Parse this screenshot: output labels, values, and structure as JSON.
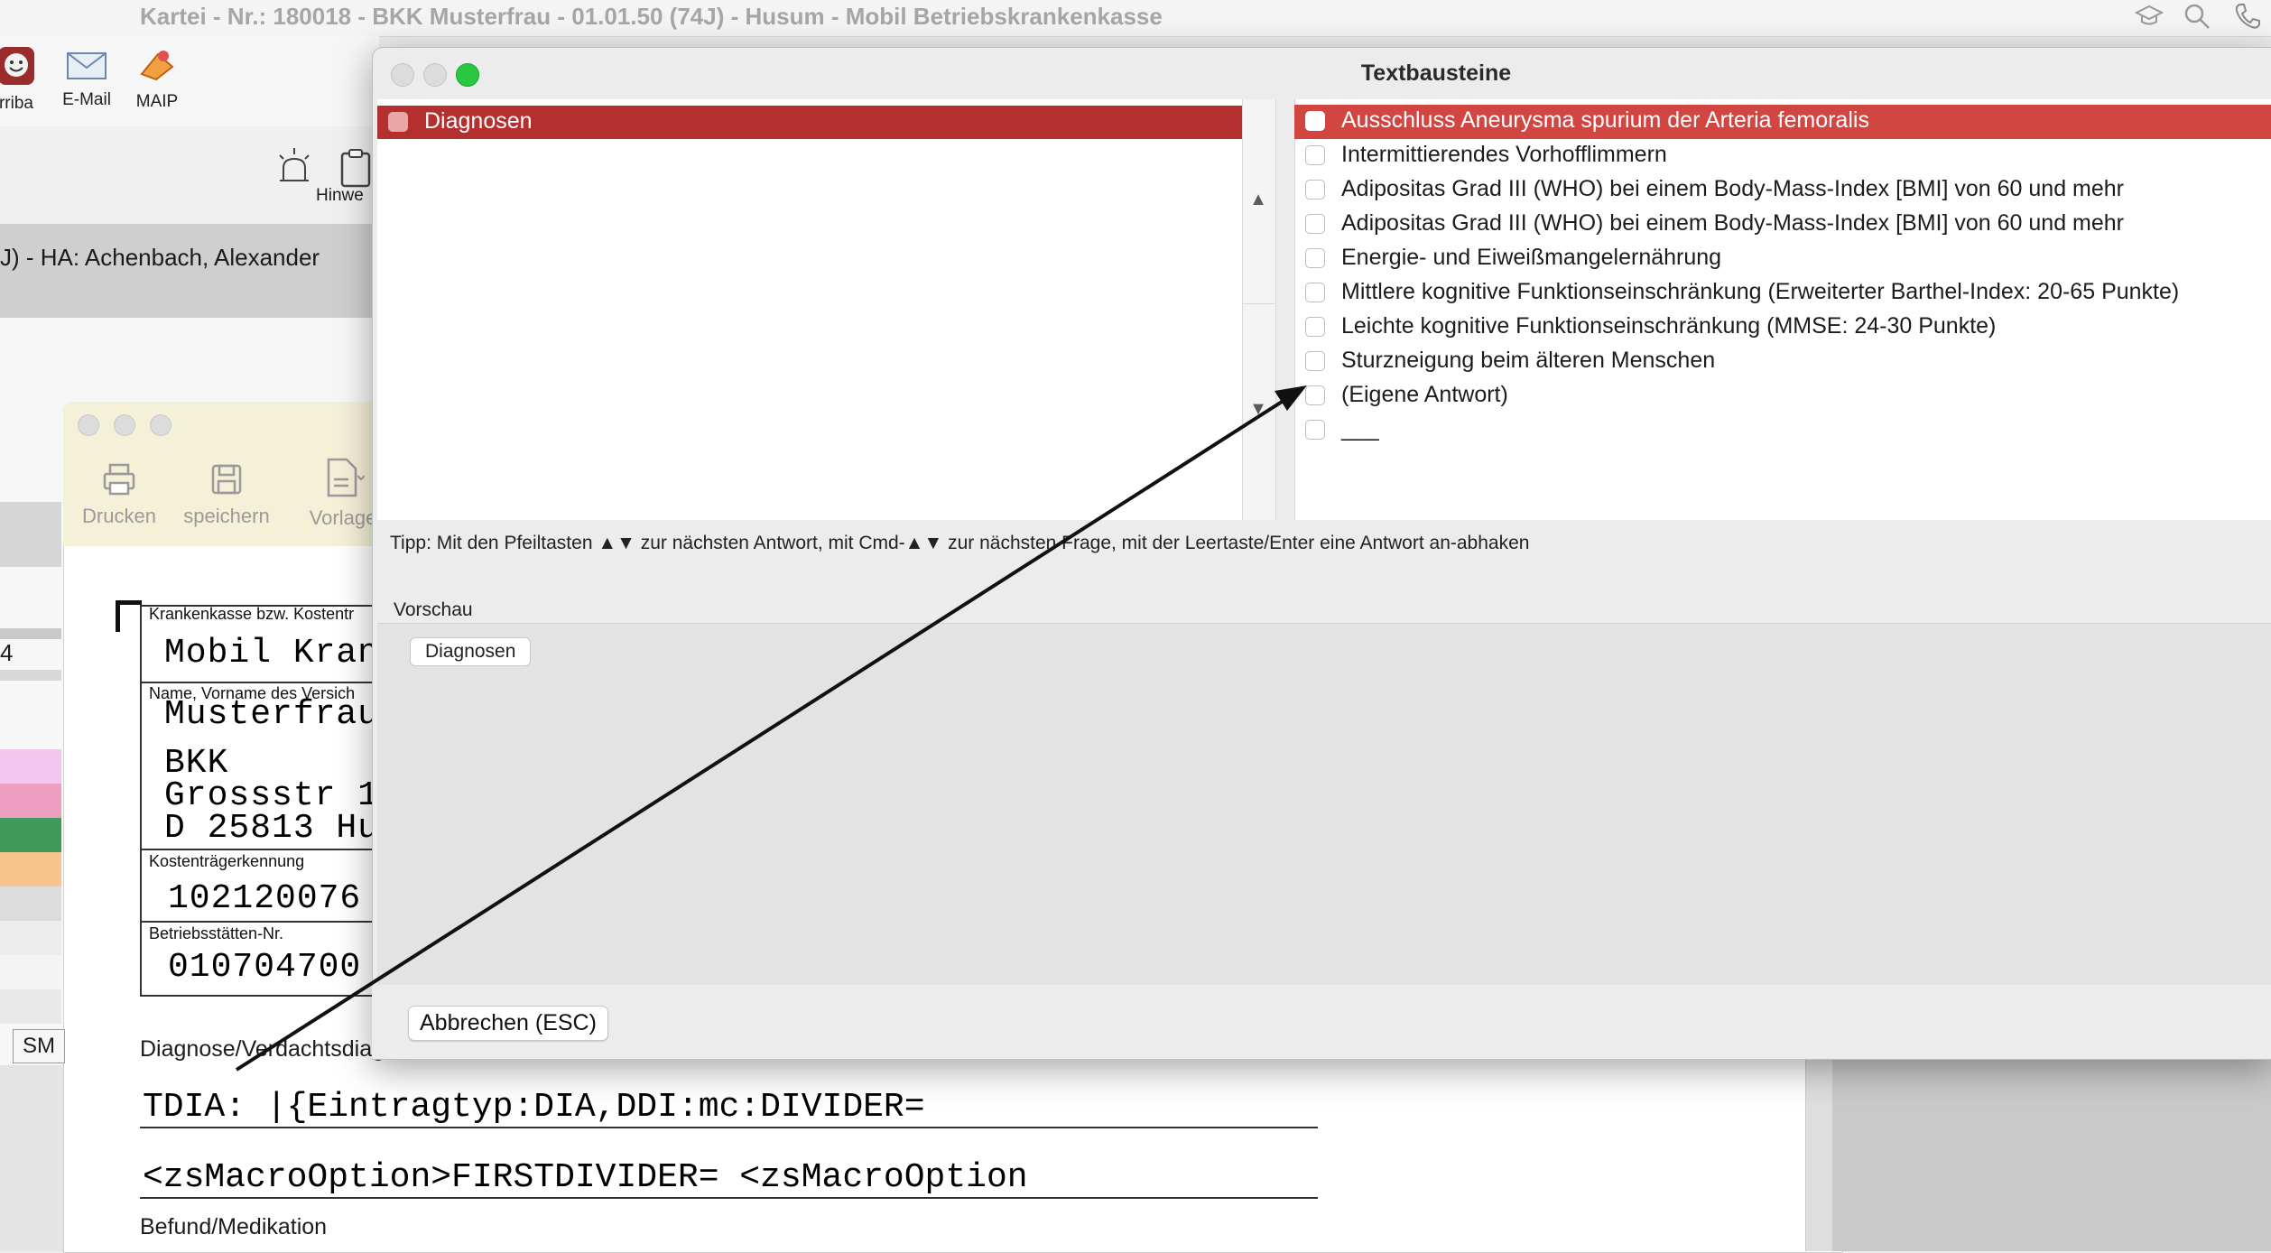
{
  "main_window": {
    "title": "Kartei - Nr.: 180018 - BKK Musterfrau - 01.01.50 (74J) - Husum - Mobil Betriebskrankenkasse",
    "toolbar": [
      {
        "label": "rriba",
        "icon": "smiley-icon"
      },
      {
        "label": "E-Mail",
        "icon": "envelope-icon"
      },
      {
        "label": "MAIP",
        "icon": "maip-icon"
      }
    ],
    "toolbar_row2": [
      {
        "label": "Hinwe",
        "icon": "clipboard-icon"
      }
    ],
    "patient_line": "J) - HA: Achenbach, Alexander",
    "left_fragments": {
      "number": "4",
      "button": "SM"
    }
  },
  "form_window": {
    "toolbar": [
      {
        "label": "Drucken",
        "icon": "printer-icon"
      },
      {
        "label": "speichern",
        "icon": "save-icon"
      },
      {
        "label": "Vorlage",
        "icon": "document-icon"
      }
    ],
    "insurance": {
      "kasse_label": "Krankenkasse bzw. Kostentr",
      "kasse_value": "Mobil Kran",
      "name_label": "Name, Vorname des Versich",
      "name_value": "Musterfrau",
      "address": [
        "BKK",
        "Grossstr 1",
        "D 25813 Hu"
      ],
      "kostentraeger_label": "Kostenträgerkennung",
      "kostentraeger_value": "102120076",
      "betriebsstaetten_label": "Betriebsstätten-Nr.",
      "betriebsstaetten_value": "010704700"
    },
    "diagnose_label": "Diagnose/Verdachtsdiag",
    "tdia_line": "TDIA:    |{Eintragtyp:DIA,DDI:mc:DIVIDER=",
    "macro_line": "<zsMacroOption>FIRSTDIVIDER= <zsMacroOption",
    "befund_label": "Befund/Medikation"
  },
  "dialog": {
    "title": "Textbausteine",
    "left_list": [
      {
        "label": "Diagnosen",
        "selected": true
      }
    ],
    "right_list": [
      {
        "label": "Ausschluss Aneurysma spurium der Arteria femoralis",
        "selected": true
      },
      {
        "label": "Intermittierendes Vorhofflimmern",
        "selected": false
      },
      {
        "label": "Adipositas Grad III (WHO) bei einem Body-Mass-Index [BMI] von 60 und mehr",
        "selected": false
      },
      {
        "label": "Adipositas Grad III (WHO) bei einem Body-Mass-Index [BMI] von 60 und mehr",
        "selected": false
      },
      {
        "label": "Energie- und Eiweißmangelernährung",
        "selected": false
      },
      {
        "label": "Mittlere kognitive Funktionseinschränkung (Erweiterter Barthel-Index: 20-65 Punkte)",
        "selected": false
      },
      {
        "label": "Leichte kognitive Funktionseinschränkung (MMSE: 24-30 Punkte)",
        "selected": false
      },
      {
        "label": "Sturzneigung beim älteren Menschen",
        "selected": false
      },
      {
        "label": "(Eigene Antwort)",
        "selected": false
      },
      {
        "label": "___",
        "selected": false
      }
    ],
    "tip": "Tipp: Mit den Pfeiltasten ▲▼ zur nächsten Antwort, mit Cmd-▲▼  zur nächsten Frage, mit der Leertaste/Enter eine Antwort an-abhaken",
    "preview_label": "Vorschau",
    "preview_chip": "Diagnosen",
    "cancel_button": "Abbrechen (ESC)"
  },
  "colors": {
    "selection_dark": "#b3302f",
    "selection_light": "#d24642",
    "traffic_close": "#ff5f57",
    "traffic_min": "#febc2e",
    "traffic_max": "#28c840",
    "annotation_arrow": "#111111"
  }
}
